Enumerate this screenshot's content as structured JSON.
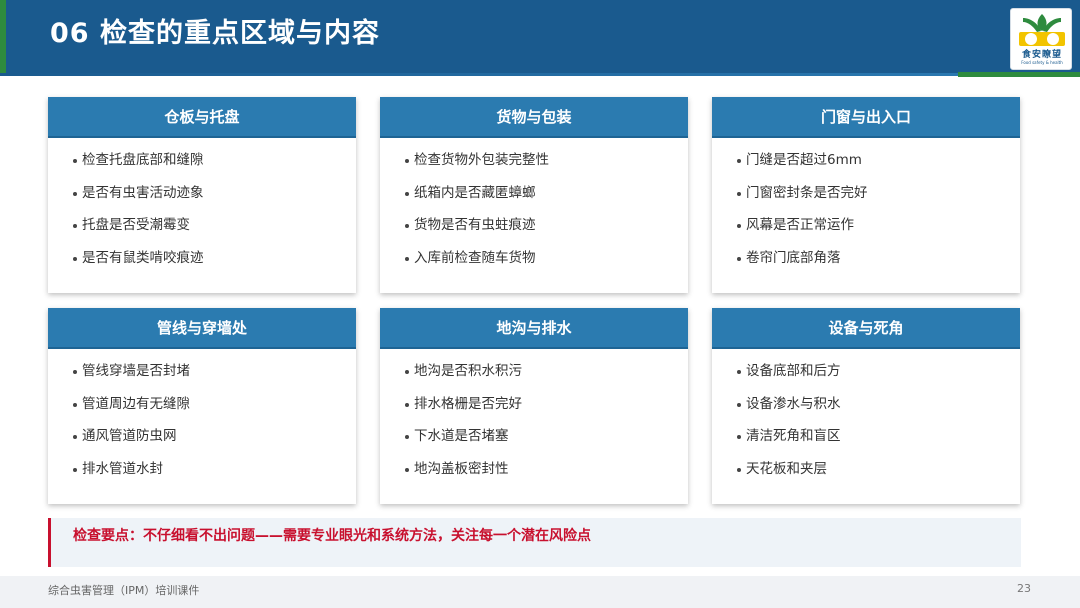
{
  "header": {
    "title": "06  检查的重点区域与内容",
    "logo_text": "食安瞭望",
    "logo_sub": "Food safety & health"
  },
  "cards": [
    {
      "title": "仓板与托盘",
      "items": [
        "检查托盘底部和缝隙",
        "是否有虫害活动迹象",
        "托盘是否受潮霉变",
        "是否有鼠类啃咬痕迹"
      ]
    },
    {
      "title": "货物与包装",
      "items": [
        "检查货物外包装完整性",
        "纸箱内是否藏匿蟑螂",
        "货物是否有虫蛀痕迹",
        "入库前检查随车货物"
      ]
    },
    {
      "title": "门窗与出入口",
      "items": [
        "门缝是否超过6mm",
        "门窗密封条是否完好",
        "风幕是否正常运作",
        "卷帘门底部角落"
      ]
    },
    {
      "title": "管线与穿墙处",
      "items": [
        "管线穿墙是否封堵",
        "管道周边有无缝隙",
        "通风管道防虫网",
        "排水管道水封"
      ]
    },
    {
      "title": "地沟与排水",
      "items": [
        "地沟是否积水积污",
        "排水格栅是否完好",
        "下水道是否堵塞",
        "地沟盖板密封性"
      ]
    },
    {
      "title": "设备与死角",
      "items": [
        "设备底部和后方",
        "设备渗水与积水",
        "清洁死角和盲区",
        "天花板和夹层"
      ]
    }
  ],
  "keypoint": {
    "text": "检查要点：不仔细看不出问题——需要专业眼光和系统方法，关注每一个潜在风险点"
  },
  "footer": {
    "left": "综合虫害管理（IPM）培训课件",
    "page": "23"
  },
  "colors": {
    "header_blue": "#1a5a8e",
    "card_head_blue": "#2b7bb0",
    "accent_green": "#2e8b3e",
    "keypoint_red": "#c8102e"
  }
}
